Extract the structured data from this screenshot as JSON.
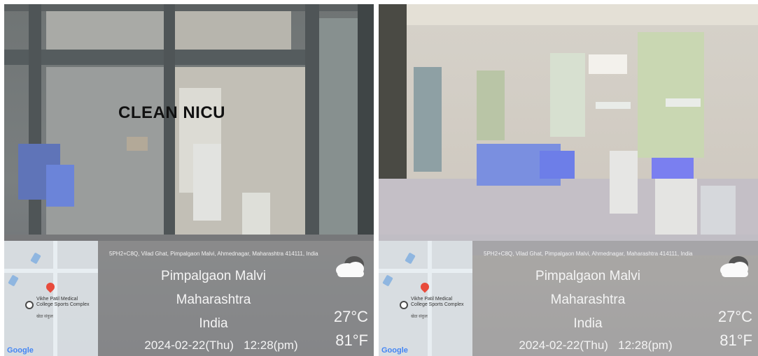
{
  "panels": [
    {
      "sign_text": "CLEAN NICU",
      "address": "5PH2+C8Q, Vilad Ghat, Pimpalgaon Malvi, Ahmednagar, Maharashtra 414111, India",
      "locality": "Pimpalgaon Malvi",
      "state": "Maharashtra",
      "country": "India",
      "date": "2024-02-22(Thu)",
      "time": "12:28(pm)",
      "temp_c": "27°C",
      "temp_f": "81°F",
      "map_poi": "Vikhe Patil Medical College Sports Complex",
      "map_poi_sub": "खेळ संकुल",
      "map_brand": "Google"
    },
    {
      "address": "5PH2+C8Q, Vilad Ghat, Pimpalgaon Malvi, Ahmednagar, Maharashtra 414111, India",
      "locality": "Pimpalgaon Malvi",
      "state": "Maharashtra",
      "country": "India",
      "date": "2024-02-22(Thu)",
      "time": "12:28(pm)",
      "temp_c": "27°C",
      "temp_f": "81°F",
      "map_poi": "Vikhe Patil Medical College Sports Complex",
      "map_poi_sub": "खेळ संकुल",
      "map_brand": "Google"
    }
  ],
  "weather_icon": "cloud-icon"
}
